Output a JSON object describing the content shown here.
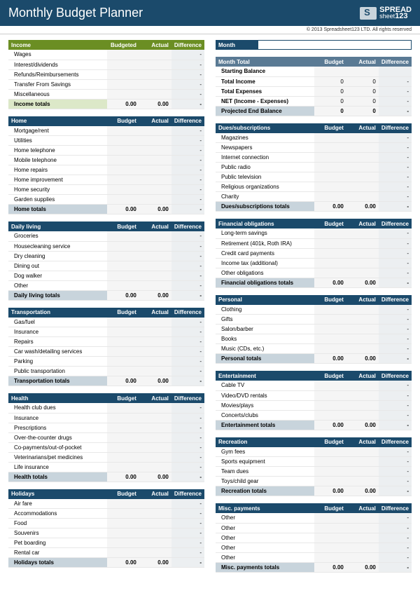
{
  "title": "Monthly Budget Planner",
  "brand": {
    "line1": "SPREAD",
    "line2": "sheet",
    "suffix": "123"
  },
  "copyright": "© 2013 Spreadsheet123 LTD. All rights reserved",
  "cols": {
    "budgeted": "Budgeted",
    "budget": "Budget",
    "actual": "Actual",
    "diff": "Difference"
  },
  "dash": "-",
  "zero": "0",
  "zz": "0.00",
  "month": {
    "label": "Month",
    "value": ""
  },
  "monthTotal": {
    "title": "Month Total",
    "rows": [
      "Starting Balance",
      "Total Income",
      "Total Expenses",
      "NET (Income - Expenses)"
    ],
    "proj": "Projected End Balance"
  },
  "left": [
    {
      "title": "Income",
      "green": true,
      "totals": "Income totals",
      "rows": [
        "Wages",
        "Interest/dividends",
        "Refunds/Reimbursements",
        "Transfer From Savings",
        "Miscellaneous"
      ]
    },
    {
      "title": "Home",
      "totals": "Home totals",
      "rows": [
        "Mortgage/rent",
        "Utilities",
        "Home telephone",
        "Mobile telephone",
        "Home repairs",
        "Home improvement",
        "Home security",
        "Garden supplies"
      ]
    },
    {
      "title": "Daily living",
      "totals": "Daily living totals",
      "rows": [
        "Groceries",
        "Housecleaning service",
        "Dry cleaning",
        "Dining out",
        "Dog walker",
        "Other"
      ]
    },
    {
      "title": "Transportation",
      "totals": "Transportation totals",
      "rows": [
        "Gas/fuel",
        "Insurance",
        "Repairs",
        "Car wash/detailing services",
        "Parking",
        "Public transportation"
      ]
    },
    {
      "title": "Health",
      "totals": "Health totals",
      "rows": [
        "Health club dues",
        "Insurance",
        "Prescriptions",
        "Over-the-counter drugs",
        "Co-payments/out-of-pocket",
        "Veterinarians/pet medicines",
        "Life insurance"
      ]
    },
    {
      "title": "Holidays",
      "totals": "Holidays totals",
      "rows": [
        "Air fare",
        "Accommodations",
        "Food",
        "Souvenirs",
        "Pet boarding",
        "Rental car"
      ]
    }
  ],
  "right": [
    {
      "title": "Dues/subscriptions",
      "totals": "Dues/subscriptions totals",
      "rows": [
        "Magazines",
        "Newspapers",
        "Internet connection",
        "Public radio",
        "Public television",
        "Religious organizations",
        "Charity"
      ]
    },
    {
      "title": "Financial obligations",
      "totals": "Financial obligations totals",
      "rows": [
        "Long-term savings",
        "Retirement (401k, Roth IRA)",
        "Credit card payments",
        "Income tax (additional)",
        "Other obligations"
      ]
    },
    {
      "title": "Personal",
      "totals": "Personal totals",
      "rows": [
        "Clothing",
        "Gifts",
        "Salon/barber",
        "Books",
        "Music (CDs, etc.)"
      ]
    },
    {
      "title": "Entertainment",
      "totals": "Entertainment totals",
      "rows": [
        "Cable TV",
        "Video/DVD rentals",
        "Movies/plays",
        "Concerts/clubs"
      ]
    },
    {
      "title": "Recreation",
      "totals": "Recreation totals",
      "rows": [
        "Gym fees",
        "Sports equipment",
        "Team dues",
        "Toys/child gear"
      ]
    },
    {
      "title": "Misc. payments",
      "totals": "Misc. payments totals",
      "rows": [
        "Other",
        "Other",
        "Other",
        "Other",
        "Other"
      ]
    }
  ]
}
